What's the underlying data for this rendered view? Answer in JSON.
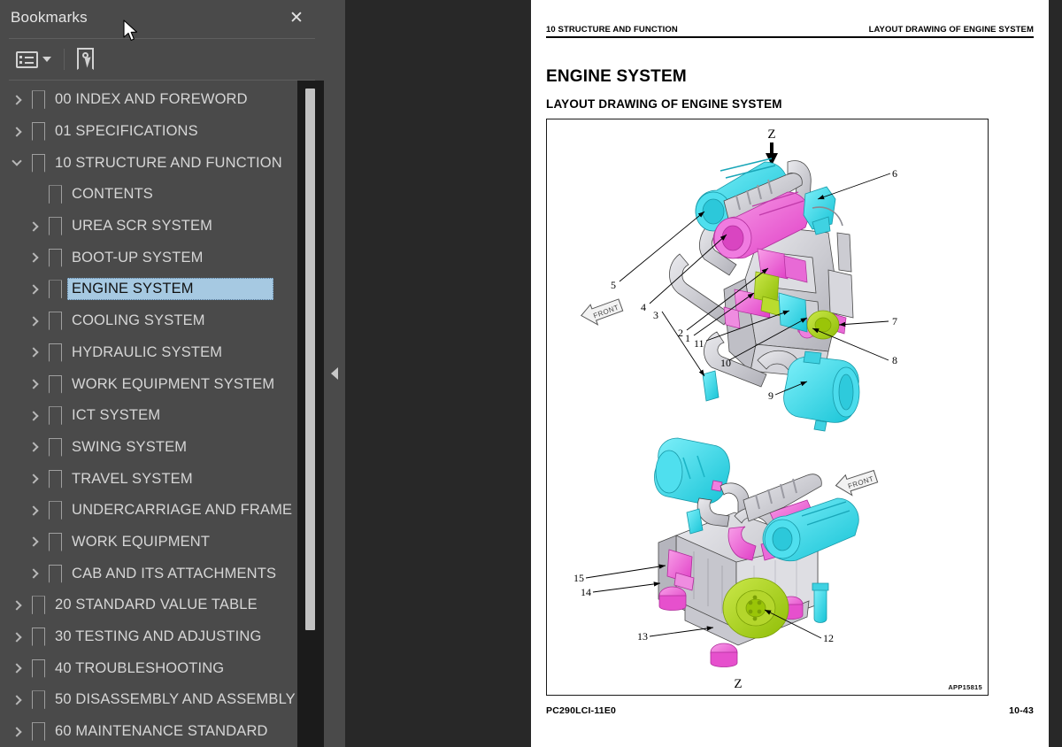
{
  "sidebar": {
    "title": "Bookmarks",
    "close_label": "✕",
    "toolbar": {
      "options_label": "Bookmark options",
      "find_label": "Find bookmark"
    },
    "items": [
      {
        "label": "00 INDEX AND FOREWORD",
        "level": 0,
        "state": "collapsed",
        "selected": false
      },
      {
        "label": "01 SPECIFICATIONS",
        "level": 0,
        "state": "collapsed",
        "selected": false
      },
      {
        "label": "10 STRUCTURE AND FUNCTION",
        "level": 0,
        "state": "expanded",
        "selected": false
      },
      {
        "label": "CONTENTS",
        "level": 1,
        "state": "leaf",
        "selected": false
      },
      {
        "label": "UREA SCR SYSTEM",
        "level": 1,
        "state": "collapsed",
        "selected": false
      },
      {
        "label": "BOOT-UP SYSTEM",
        "level": 1,
        "state": "collapsed",
        "selected": false
      },
      {
        "label": "ENGINE SYSTEM",
        "level": 1,
        "state": "collapsed",
        "selected": true
      },
      {
        "label": "COOLING SYSTEM",
        "level": 1,
        "state": "collapsed",
        "selected": false
      },
      {
        "label": "HYDRAULIC SYSTEM",
        "level": 1,
        "state": "collapsed",
        "selected": false
      },
      {
        "label": "WORK EQUIPMENT SYSTEM",
        "level": 1,
        "state": "collapsed",
        "selected": false
      },
      {
        "label": "ICT SYSTEM",
        "level": 1,
        "state": "collapsed",
        "selected": false
      },
      {
        "label": "SWING SYSTEM",
        "level": 1,
        "state": "collapsed",
        "selected": false
      },
      {
        "label": "TRAVEL SYSTEM",
        "level": 1,
        "state": "collapsed",
        "selected": false
      },
      {
        "label": "UNDERCARRIAGE AND FRAME",
        "level": 1,
        "state": "collapsed",
        "selected": false
      },
      {
        "label": "WORK EQUIPMENT",
        "level": 1,
        "state": "collapsed",
        "selected": false
      },
      {
        "label": "CAB AND ITS ATTACHMENTS",
        "level": 1,
        "state": "collapsed",
        "selected": false
      },
      {
        "label": "20 STANDARD VALUE TABLE",
        "level": 0,
        "state": "collapsed",
        "selected": false
      },
      {
        "label": "30 TESTING AND ADJUSTING",
        "level": 0,
        "state": "collapsed",
        "selected": false
      },
      {
        "label": "40 TROUBLESHOOTING",
        "level": 0,
        "state": "collapsed",
        "selected": false
      },
      {
        "label": "50 DISASSEMBLY AND ASSEMBLY",
        "level": 0,
        "state": "collapsed",
        "selected": false
      },
      {
        "label": "60 MAINTENANCE STANDARD",
        "level": 0,
        "state": "collapsed",
        "selected": false
      }
    ]
  },
  "document": {
    "header_left": "10 STRUCTURE AND FUNCTION",
    "header_right": "LAYOUT DRAWING OF ENGINE SYSTEM",
    "heading": "ENGINE SYSTEM",
    "subheading": "LAYOUT DRAWING OF ENGINE SYSTEM",
    "figure_code": "APP15815",
    "footer_left": "PC290LCI-11E0",
    "footer_right": "10-43",
    "figure": {
      "view_label_top": "Z",
      "view_label_bottom": "Z",
      "direction_label": "FRONT",
      "callouts_top": [
        "1",
        "2",
        "3",
        "4",
        "5",
        "6",
        "7",
        "8",
        "9",
        "10",
        "11"
      ],
      "callouts_bottom": [
        "12",
        "13",
        "14",
        "15"
      ]
    }
  },
  "colors": {
    "panel_bg": "#4a4a4a",
    "viewer_bg": "#282828",
    "selection": "#a6c9e2",
    "text": "#d6d6d6",
    "scrollbar_track": "#1b1b1b",
    "scrollbar_thumb": "#c2c2c2",
    "part_cyan": "#35d9e8",
    "part_magenta": "#e84ed0",
    "part_lime": "#a8d418",
    "part_gray": "#c8c8cc"
  }
}
